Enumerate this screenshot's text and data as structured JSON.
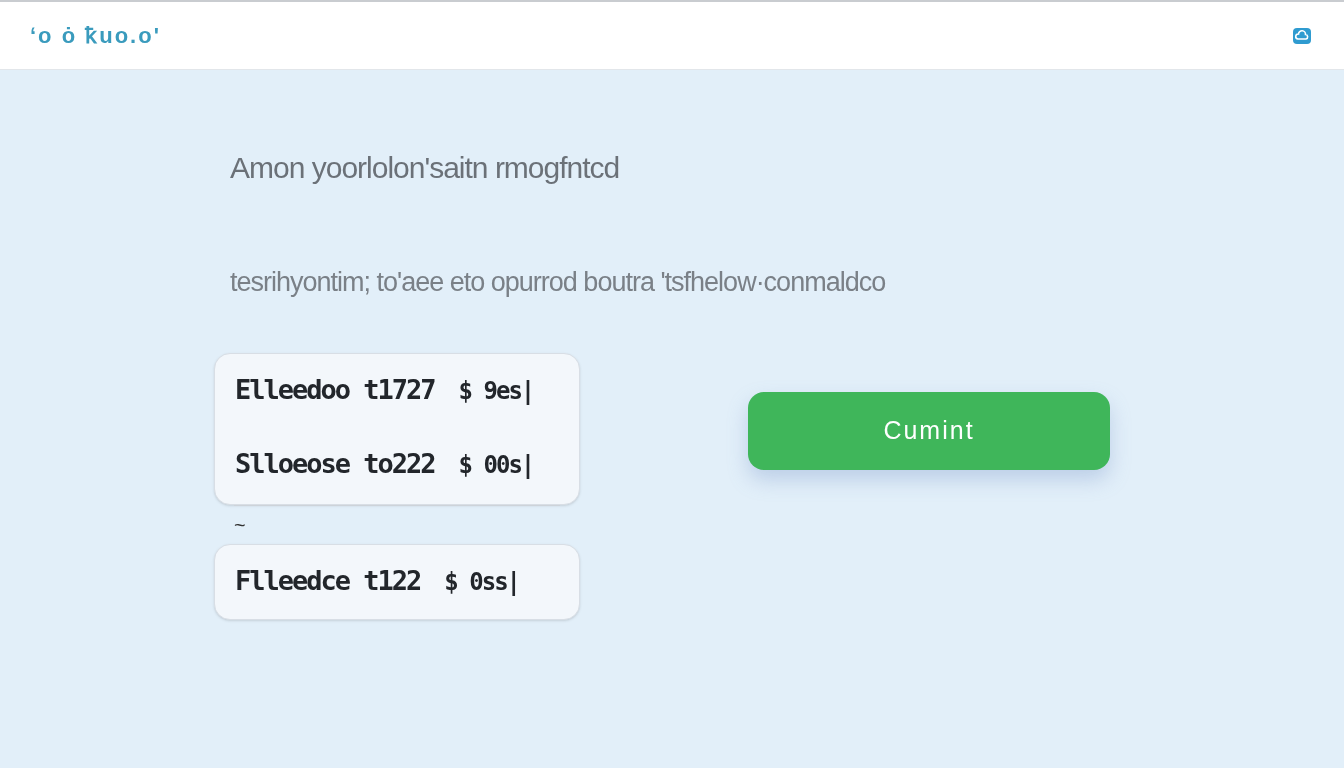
{
  "header": {
    "logo": "ʻo ȯ ꝁuo.o'"
  },
  "heading": "Amon yoorlolon'saitn rmogfntcd",
  "description": "tesrihyontim; to'aee eto opurrod boutra 'tsfhelow·conmaldco",
  "orders": [
    {
      "name": "Elleedoo t1727",
      "price": "$ 9es|"
    },
    {
      "name": "Slloeose to222",
      "price": "$ 00s|"
    }
  ],
  "separator_mark": "~",
  "more_orders": [
    {
      "name": "Flleedce t122",
      "price": "$ 0ss|"
    }
  ],
  "submit_button": "Cumint"
}
